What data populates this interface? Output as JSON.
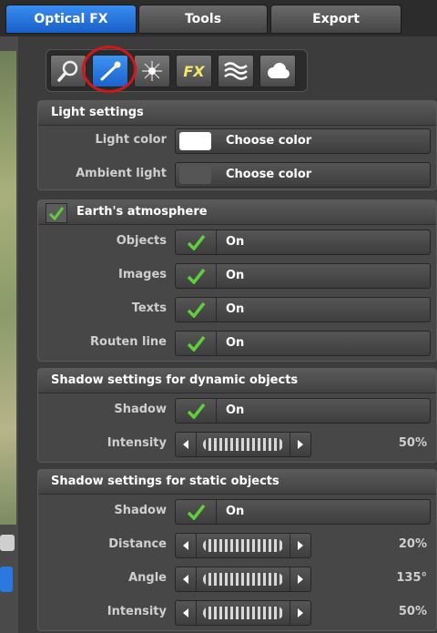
{
  "tabs": [
    {
      "label": "Optical FX",
      "active": true
    },
    {
      "label": "Tools",
      "active": false
    },
    {
      "label": "Export",
      "active": false
    }
  ],
  "toolbar": {
    "buttons": [
      {
        "icon": "magnifier-icon",
        "selected": false
      },
      {
        "icon": "light-wand-icon",
        "selected": true
      },
      {
        "icon": "sun-flare-icon",
        "selected": false
      },
      {
        "icon": "fx-icon",
        "label": "FX",
        "selected": false
      },
      {
        "icon": "waves-icon",
        "selected": false
      },
      {
        "icon": "cloud-icon",
        "selected": false
      }
    ]
  },
  "light": {
    "header": "Light settings",
    "light_color": {
      "label": "Light color",
      "button": "Choose color",
      "swatch": "#ffffff"
    },
    "ambient": {
      "label": "Ambient light",
      "button": "Choose color",
      "swatch": "#555555"
    }
  },
  "atmos": {
    "header": "Earth's atmosphere",
    "checked": true,
    "rows": [
      {
        "label": "Objects",
        "value": "On",
        "checked": true
      },
      {
        "label": "Images",
        "value": "On",
        "checked": true
      },
      {
        "label": "Texts",
        "value": "On",
        "checked": true
      },
      {
        "label": "Routen line",
        "value": "On",
        "checked": true
      }
    ]
  },
  "dyn": {
    "header": "Shadow settings for dynamic objects",
    "shadow": {
      "label": "Shadow",
      "value": "On",
      "checked": true
    },
    "intensity": {
      "label": "Intensity",
      "value": "50%"
    }
  },
  "stat": {
    "header": "Shadow settings for static objects",
    "shadow": {
      "label": "Shadow",
      "value": "On",
      "checked": true
    },
    "distance": {
      "label": "Distance",
      "value": "20%"
    },
    "angle": {
      "label": "Angle",
      "value": "135°"
    },
    "intensity": {
      "label": "Intensity",
      "value": "50%"
    }
  },
  "colors": {
    "accent": "#2a78e0",
    "check": "#5fcf3a",
    "highlight_ring": "#d01818"
  }
}
